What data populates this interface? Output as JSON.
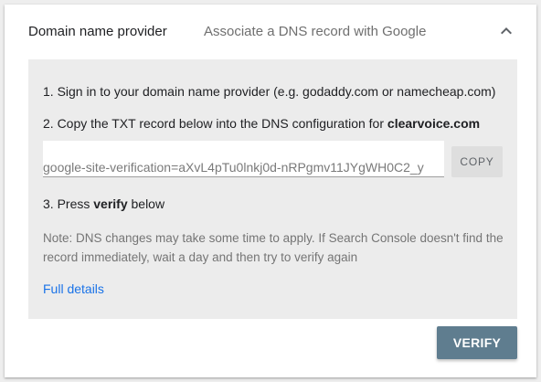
{
  "header": {
    "title": "Domain name provider",
    "description": "Associate a DNS record with Google",
    "chevron_icon": "chevron-up-icon"
  },
  "steps": {
    "step1": "1. Sign in to your domain name provider (e.g. godaddy.com or namecheap.com)",
    "step2_prefix": "2. Copy the TXT record below into the DNS configuration for ",
    "step2_domain": "clearvoice.com",
    "step3_prefix": "3. Press ",
    "step3_bold": "verify",
    "step3_suffix": " below"
  },
  "txt_record": {
    "value": "google-site-verification=aXvL4pTu0lnkj0d-nRPgmv11JYgWH0C2_y"
  },
  "copy_button": {
    "label": "COPY"
  },
  "note": "Note: DNS changes may take some time to apply. If Search Console doesn't find the record immediately, wait a day and then try to verify again",
  "full_details_link": "Full details",
  "verify_button": {
    "label": "VERIFY"
  },
  "colors": {
    "panel_background": "#ececec",
    "link": "#1a73e8",
    "verify_button": "#5f7d8f",
    "copy_button": "#dedede"
  }
}
